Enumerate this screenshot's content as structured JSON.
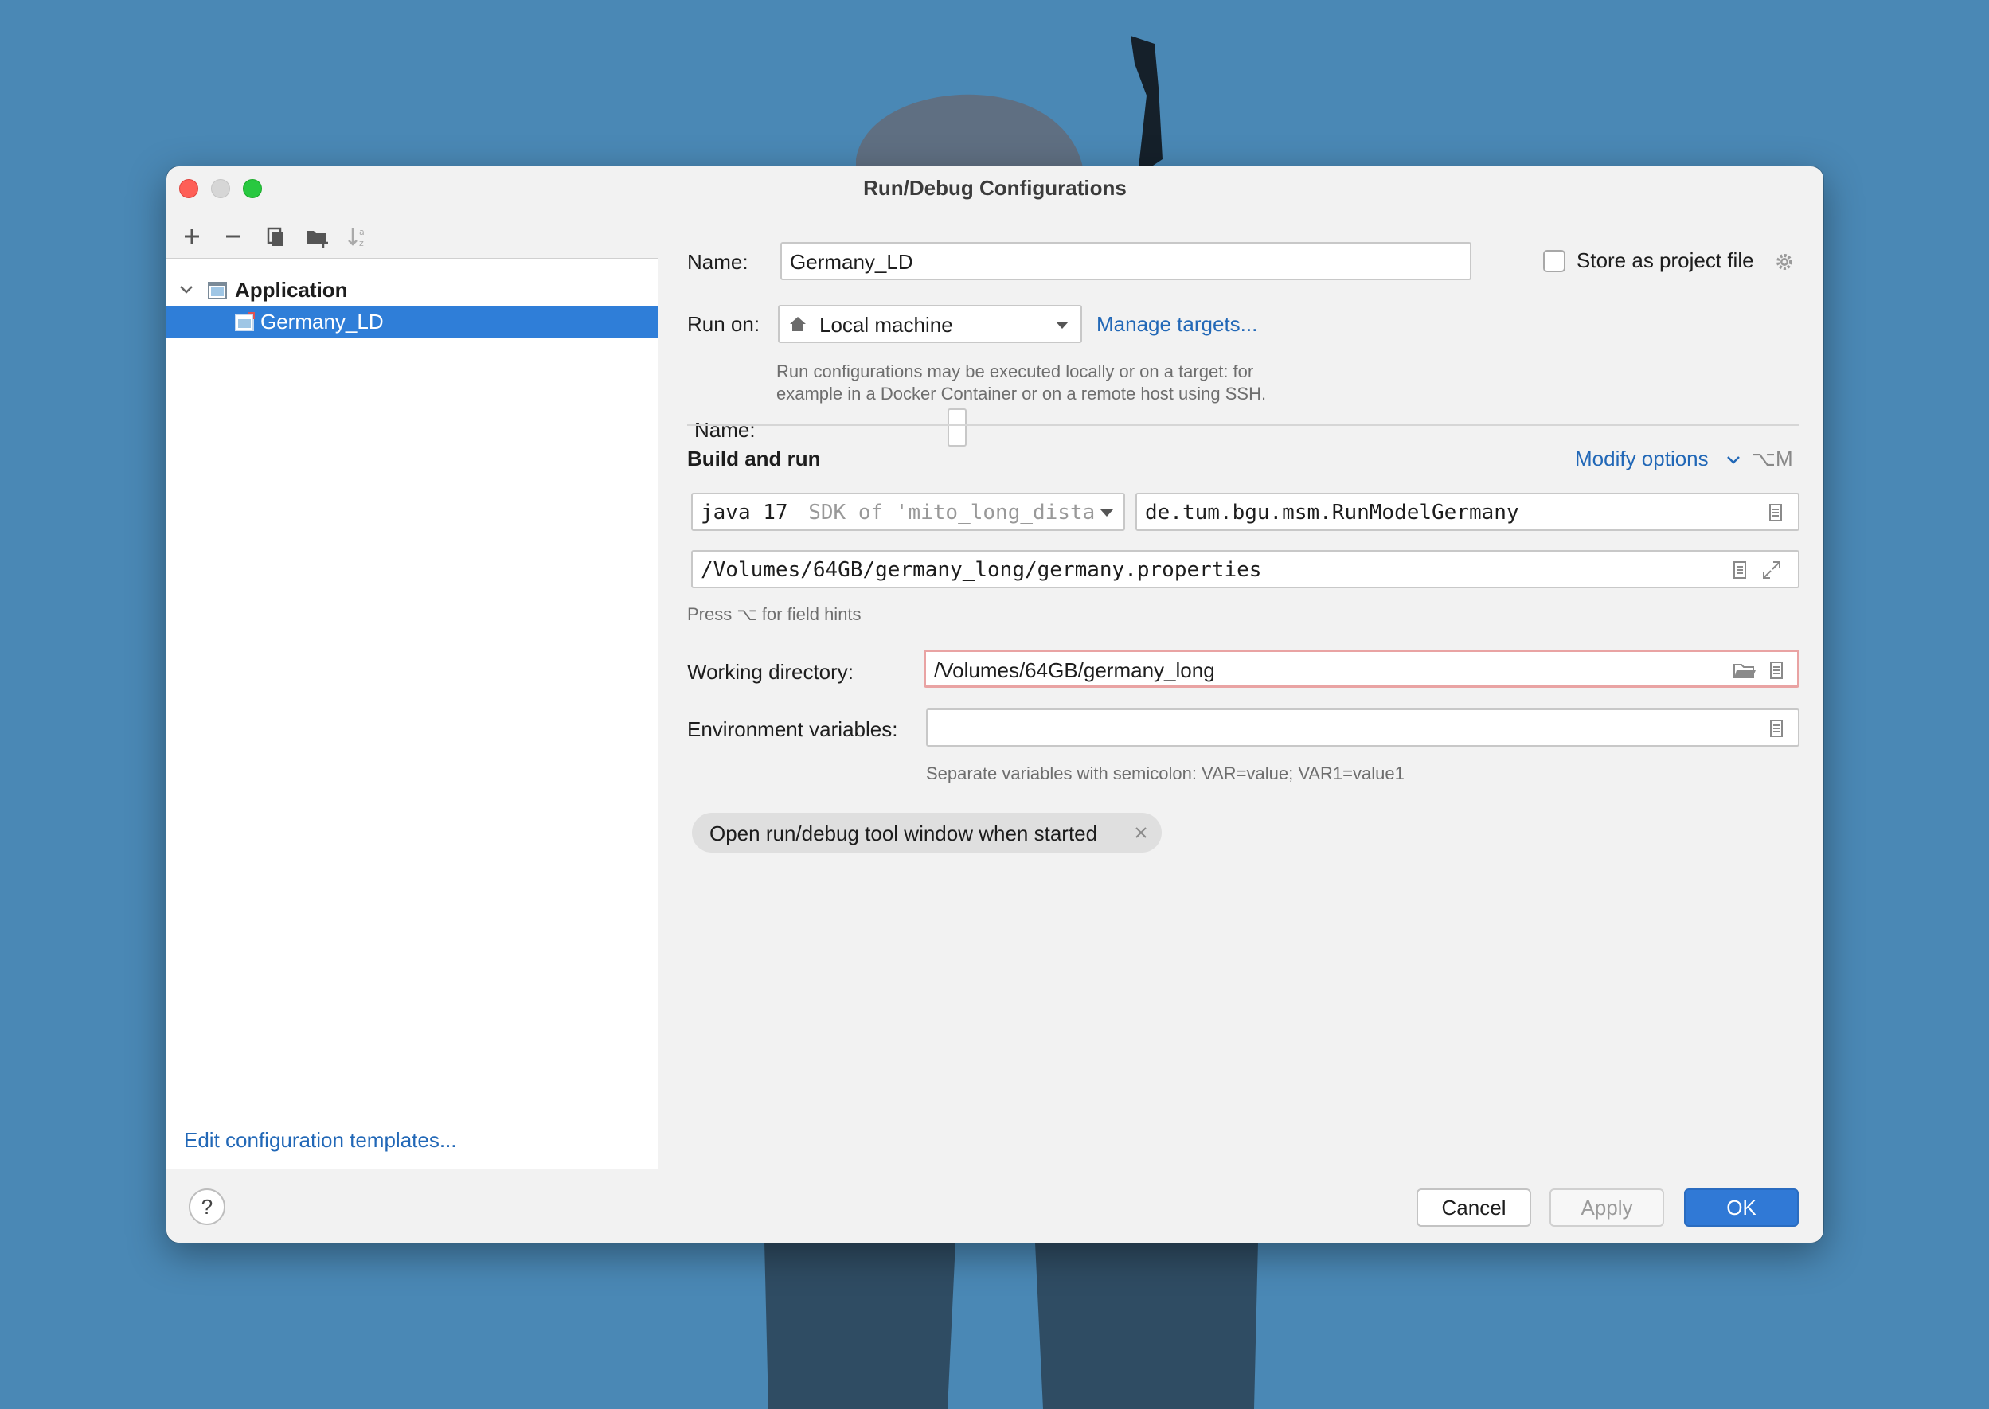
{
  "window": {
    "title": "Run/Debug Configurations"
  },
  "left_panel": {
    "toolbar": [
      "add",
      "remove",
      "copy",
      "new-folder",
      "sort"
    ],
    "tree": {
      "group_label": "Application",
      "selected_item": "Germany_LD"
    },
    "edit_templates_link": "Edit configuration templates..."
  },
  "form": {
    "name_label": "Name:",
    "name_value": "Germany_LD",
    "store_label": "Store as project file",
    "store_checked": false,
    "run_on_label": "Run on:",
    "run_on_value": "Local machine",
    "manage_targets": "Manage targets...",
    "run_on_hint_line1": "Run configurations may be executed locally or on a target: for",
    "run_on_hint_line2": "example in a Docker Container or on a remote host using SSH.",
    "section_title": "Build and run",
    "modify_options": "Modify options",
    "modify_shortcut": "⌥M",
    "jdk_main": "java 17",
    "jdk_detail": "SDK of 'mito_long_dista",
    "main_class": "de.tum.bgu.msm.RunModelGermany",
    "program_args": "/Volumes/64GB/germany_long/germany.properties",
    "field_hint": "Press ⌥ for field hints",
    "workdir_label": "Working directory:",
    "workdir_value": "/Volumes/64GB/germany_long",
    "env_label": "Environment variables:",
    "env_value": "",
    "env_hint": "Separate variables with semicolon: VAR=value; VAR1=value1",
    "chip_label": "Open run/debug tool window when started"
  },
  "buttons": {
    "help": "?",
    "cancel": "Cancel",
    "apply": "Apply",
    "ok": "OK"
  },
  "colors": {
    "accent": "#2f7ed8",
    "link": "#2268b7",
    "error_border": "#e9a3a3",
    "desktop": "#4a88b5"
  }
}
